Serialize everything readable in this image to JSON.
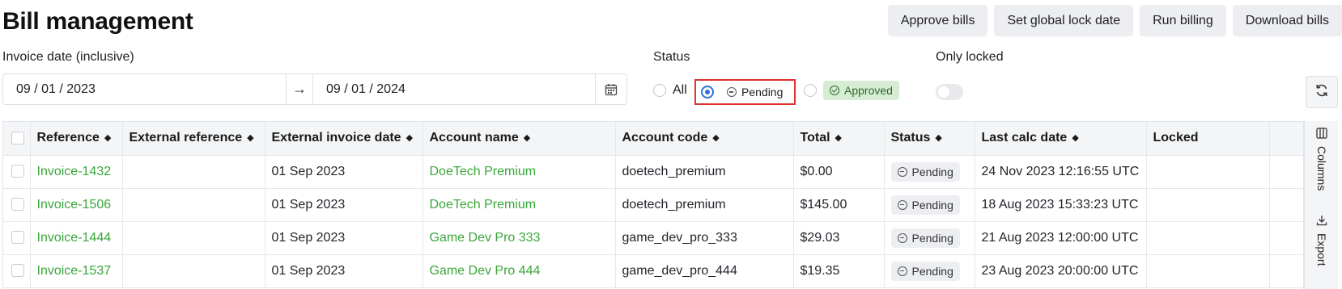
{
  "page": {
    "title": "Bill management"
  },
  "actions": {
    "approve": "Approve bills",
    "lock_date": "Set global lock date",
    "run_billing": "Run billing",
    "download": "Download bills"
  },
  "filters": {
    "invoice_date_label": "Invoice date (inclusive)",
    "start_date": "09 / 01 / 2023",
    "arrow": "→",
    "end_date": "09 / 01 / 2024",
    "status_label": "Status",
    "status_options": {
      "all": "All",
      "pending": "Pending",
      "approved": "Approved"
    },
    "status_selected": "pending",
    "only_locked_label": "Only locked",
    "only_locked": false
  },
  "table": {
    "headers": {
      "reference": "Reference",
      "external_reference": "External reference",
      "external_invoice_date": "External invoice date",
      "account_name": "Account name",
      "account_code": "Account code",
      "total": "Total",
      "status": "Status",
      "last_calc_date": "Last calc date",
      "locked": "Locked"
    },
    "rows": [
      {
        "reference": "Invoice-1432",
        "external_reference": "",
        "external_invoice_date": "01 Sep 2023",
        "account_name": "DoeTech Premium",
        "account_code": "doetech_premium",
        "total": "$0.00",
        "status": "Pending",
        "last_calc_date": "24 Nov 2023 12:16:55 UTC",
        "locked": ""
      },
      {
        "reference": "Invoice-1506",
        "external_reference": "",
        "external_invoice_date": "01 Sep 2023",
        "account_name": "DoeTech Premium",
        "account_code": "doetech_premium",
        "total": "$145.00",
        "status": "Pending",
        "last_calc_date": "18 Aug 2023 15:33:23 UTC",
        "locked": ""
      },
      {
        "reference": "Invoice-1444",
        "external_reference": "",
        "external_invoice_date": "01 Sep 2023",
        "account_name": "Game Dev Pro 333",
        "account_code": "game_dev_pro_333",
        "total": "$29.03",
        "status": "Pending",
        "last_calc_date": "21 Aug 2023 12:00:00 UTC",
        "locked": ""
      },
      {
        "reference": "Invoice-1537",
        "external_reference": "",
        "external_invoice_date": "01 Sep 2023",
        "account_name": "Game Dev Pro 444",
        "account_code": "game_dev_pro_444",
        "total": "$19.35",
        "status": "Pending",
        "last_calc_date": "23 Aug 2023 20:00:00 UTC",
        "locked": ""
      }
    ]
  },
  "side_panel": {
    "columns": "Columns",
    "export": "Export"
  },
  "colors": {
    "link": "#3aa63a",
    "highlight": "#e03030",
    "radio_selected": "#2f6fe0",
    "approved_bg": "#d6ecd3"
  }
}
